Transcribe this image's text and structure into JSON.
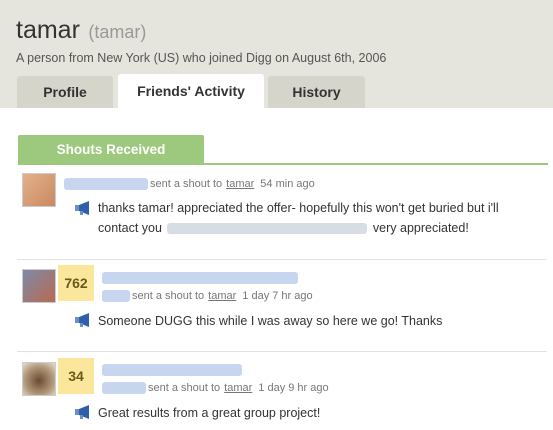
{
  "header": {
    "username": "tamar",
    "alias": "(tamar)",
    "subtitle": "A person from New York (US) who joined Digg on August 6th, 2006"
  },
  "tabs": [
    {
      "label": "Profile",
      "active": false
    },
    {
      "label": "Friends' Activity",
      "active": true
    },
    {
      "label": "History",
      "active": false
    }
  ],
  "section": {
    "title": "Shouts Received"
  },
  "shouts": [
    {
      "sent_text": "sent a shout to",
      "recipient": "tamar",
      "time": "54 min ago",
      "message_start": "thanks tamar! appreciated the offer- hopefully this won't get buried but i'll contact you",
      "message_end": "very appreciated!"
    },
    {
      "digg_count": "762",
      "sent_text": "sent a shout to",
      "recipient": "tamar",
      "time": "1 day 7 hr ago",
      "message": "Someone DUGG this while I was away so here we go! Thanks"
    },
    {
      "digg_count": "34",
      "sent_text": "sent a shout to",
      "recipient": "tamar",
      "time": "1 day 9 hr ago",
      "message": "Great results from a great group project!"
    }
  ],
  "colors": {
    "accent_green": "#9cc97e",
    "badge_yellow": "#fbe79b",
    "header_bg": "#e6e5dd"
  },
  "icons": {
    "shout": "megaphone-icon"
  }
}
